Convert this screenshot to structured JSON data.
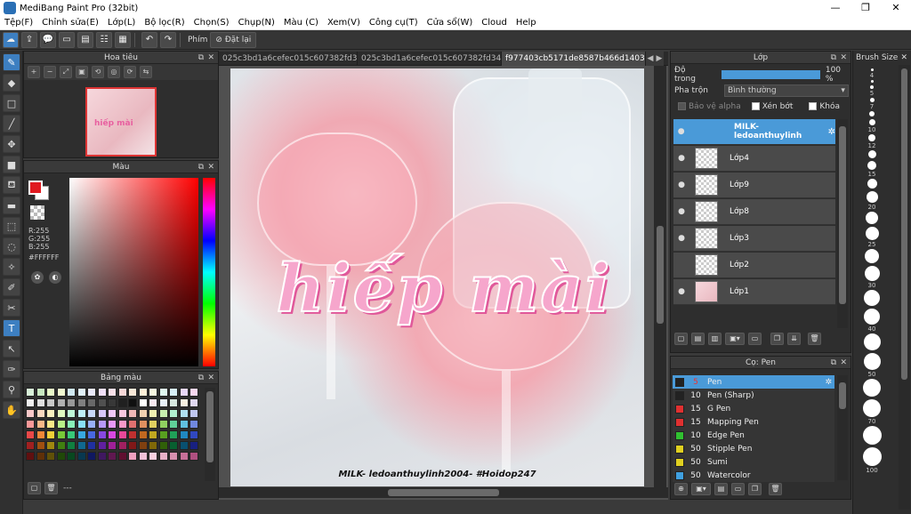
{
  "window": {
    "title": "MediBang Paint Pro (32bit)",
    "minimize": "—",
    "maximize": "❐",
    "close": "✕"
  },
  "menu": [
    "Tệp(F)",
    "Chỉnh sửa(E)",
    "Lớp(L)",
    "Bộ lọc(R)",
    "Chọn(S)",
    "Chụp(N)",
    "Màu (C)",
    "Xem(V)",
    "Công cụ(T)",
    "Cửa sổ(W)",
    "Cloud",
    "Help"
  ],
  "toolbar": {
    "snap_label": "Phím",
    "clear_label": "Đặt lại"
  },
  "navigator": {
    "title": "Hoa tiêu",
    "thumb_text": "hiếp mài"
  },
  "color": {
    "title": "Màu",
    "r": "R:255",
    "g": "G:255",
    "b": "B:255",
    "hex": "#FFFFFF",
    "fg": "#e01a20"
  },
  "palette": {
    "title": "Bảng màu",
    "footer_text": "---",
    "colors": [
      "#d8f0d8",
      "#c8e8c0",
      "#e8f8c8",
      "#f0f8d0",
      "#d0e8f0",
      "#e0f0f8",
      "#e8e8f8",
      "#f0e0f8",
      "#f8e0e8",
      "#f8d8d8",
      "#f8e8d8",
      "#fff0d8",
      "#f8f8e0",
      "#e0f8f0",
      "#d8f0f8",
      "#e8d8f8",
      "#f8d8f0",
      "#f0f0f0",
      "#e0e0e0",
      "#c8c8c8",
      "#b0b0b0",
      "#989898",
      "#808080",
      "#686868",
      "#505050",
      "#383838",
      "#202020",
      "#101010",
      "#ffffff",
      "#f8e8f0",
      "#e8f0f8",
      "#d8e8e0",
      "#f8f0e0",
      "#e0d8f0",
      "#f8c8c8",
      "#f8d8c0",
      "#f8f0c0",
      "#e0f8c0",
      "#c0f8d8",
      "#c0f0f8",
      "#c8d8f8",
      "#d8c8f8",
      "#f0c8f8",
      "#f8c8e0",
      "#f0b8b8",
      "#f0d0b0",
      "#f0f0b0",
      "#c8f0b0",
      "#b0f0d0",
      "#b0e0f0",
      "#c0c8f0",
      "#f89898",
      "#f8b888",
      "#f8e888",
      "#b8f088",
      "#88f0b8",
      "#88e0f8",
      "#98b0f8",
      "#b898f8",
      "#e898f8",
      "#f898c8",
      "#e07070",
      "#e09060",
      "#e0d060",
      "#90d060",
      "#60d098",
      "#60c0e0",
      "#7088e0",
      "#e84848",
      "#f08838",
      "#f0d038",
      "#78c838",
      "#38c878",
      "#38a8e0",
      "#4868e0",
      "#8848e0",
      "#d848e0",
      "#e84898",
      "#c03030",
      "#c06820",
      "#c0a820",
      "#58a020",
      "#20a058",
      "#2088c0",
      "#3048c0",
      "#a02020",
      "#a05010",
      "#a08810",
      "#408010",
      "#108040",
      "#106890",
      "#2030a0",
      "#6020a0",
      "#a02098",
      "#a02060",
      "#801818",
      "#804010",
      "#806808",
      "#306008",
      "#086030",
      "#085070",
      "#182080",
      "#601010",
      "#603008",
      "#605008",
      "#204808",
      "#084820",
      "#083850",
      "#101860",
      "#401860",
      "#601850",
      "#601030",
      "#f0a0c0",
      "#f0c0d8",
      "#f8d0e0",
      "#e8b0c8",
      "#d890b0",
      "#c87098",
      "#b05080"
    ]
  },
  "tabs": [
    {
      "label": "025c3bd1a6cefec015c607382fd349b3.jpg",
      "active": false
    },
    {
      "label": "025c3bd1a6cefec015c607382fd349b3.jpg",
      "active": false
    },
    {
      "label": "f977403cb5171de8587b466d1403b82f.jpg",
      "active": true
    }
  ],
  "canvas": {
    "hand_text": "hiếp mài",
    "signature": "MILK- ledoanthuylinh2004- #Hoidop247"
  },
  "layers": {
    "title": "Lớp",
    "opacity_label": "Độ trong",
    "opacity_value": "100 %",
    "opacity_fraction": 1.0,
    "blend_label": "Pha trộn",
    "blend_value": "Bình thường",
    "protect_alpha": "Bảo vệ alpha",
    "clipping": "Xén bớt",
    "lock": "Khóa",
    "items": [
      {
        "name": "MILK- ledoanthuylinh",
        "selected": true
      },
      {
        "name": "Lớp4",
        "selected": false
      },
      {
        "name": "Lớp9",
        "selected": false
      },
      {
        "name": "Lớp8",
        "selected": false
      },
      {
        "name": "Lớp3",
        "selected": false
      },
      {
        "name": "Lớp2",
        "selected": false
      },
      {
        "name": "Lớp1",
        "selected": false
      }
    ]
  },
  "brushes": {
    "title": "Cọ: Pen",
    "items": [
      {
        "size": "5",
        "name": "Pen",
        "color": "#222222",
        "selected": true
      },
      {
        "size": "10",
        "name": "Pen (Sharp)",
        "color": "#222222",
        "selected": false
      },
      {
        "size": "15",
        "name": "G Pen",
        "color": "#e03030",
        "selected": false
      },
      {
        "size": "15",
        "name": "Mapping Pen",
        "color": "#e03030",
        "selected": false
      },
      {
        "size": "10",
        "name": "Edge Pen",
        "color": "#30c030",
        "selected": false
      },
      {
        "size": "50",
        "name": "Stipple Pen",
        "color": "#e0d020",
        "selected": false
      },
      {
        "size": "50",
        "name": "Sumi",
        "color": "#e0d020",
        "selected": false
      },
      {
        "size": "50",
        "name": "Watercolor",
        "color": "#40a0e0",
        "selected": false
      }
    ]
  },
  "brush_size": {
    "title": "Brush Size",
    "items": [
      "4",
      "",
      "5",
      "7",
      "",
      "10",
      "12",
      "",
      "15",
      "",
      "20",
      "",
      "25",
      "",
      "30",
      "",
      "40",
      "",
      "50",
      "",
      "70",
      "",
      "100"
    ]
  }
}
